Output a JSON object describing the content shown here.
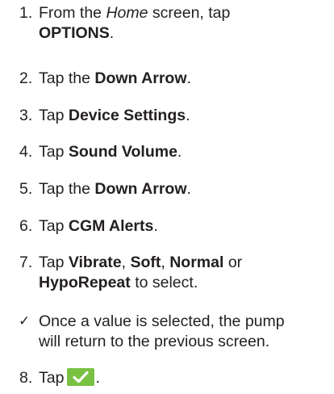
{
  "steps": [
    {
      "num": "1.",
      "parts": [
        {
          "t": "From the ",
          "s": "light"
        },
        {
          "t": "Home",
          "s": "ital"
        },
        {
          "t": " screen, tap",
          "s": "light"
        }
      ],
      "line2": [
        {
          "t": "OPTIONS",
          "s": "bold"
        },
        {
          "t": ".",
          "s": "light"
        }
      ]
    },
    {
      "num": "2.",
      "parts": [
        {
          "t": "Tap the ",
          "s": "light"
        },
        {
          "t": "Down Arrow",
          "s": "bold"
        },
        {
          "t": ".",
          "s": "light"
        }
      ]
    },
    {
      "num": "3.",
      "parts": [
        {
          "t": "Tap ",
          "s": "light"
        },
        {
          "t": "Device Settings",
          "s": "bold"
        },
        {
          "t": ".",
          "s": "light"
        }
      ]
    },
    {
      "num": "4.",
      "parts": [
        {
          "t": "Tap ",
          "s": "light"
        },
        {
          "t": "Sound Volume",
          "s": "bold"
        },
        {
          "t": ".",
          "s": "light"
        }
      ]
    },
    {
      "num": "5.",
      "parts": [
        {
          "t": "Tap the ",
          "s": "light"
        },
        {
          "t": "Down Arrow",
          "s": "bold"
        },
        {
          "t": ".",
          "s": "light"
        }
      ]
    },
    {
      "num": "6.",
      "parts": [
        {
          "t": "Tap ",
          "s": "light"
        },
        {
          "t": "CGM Alerts",
          "s": "bold"
        },
        {
          "t": ".",
          "s": "light"
        }
      ]
    },
    {
      "num": "7.",
      "parts": [
        {
          "t": "Tap ",
          "s": "light"
        },
        {
          "t": "Vibrate",
          "s": "bold"
        },
        {
          "t": ", ",
          "s": "light"
        },
        {
          "t": "Soft",
          "s": "bold"
        },
        {
          "t": ", ",
          "s": "light"
        },
        {
          "t": "Normal",
          "s": "bold"
        },
        {
          "t": " or",
          "s": "light"
        }
      ],
      "line2": [
        {
          "t": "HypoRepeat",
          "s": "bold"
        },
        {
          "t": " to select.",
          "s": "light"
        }
      ]
    }
  ],
  "note": {
    "mark": "✓",
    "line1": "Once a value is selected, the pump",
    "line2": "will return to the previous screen."
  },
  "final_step": {
    "num": "8.",
    "text": "Tap",
    "button_icon": "checkmark-icon",
    "end": "."
  },
  "colors": {
    "text": "#231f20",
    "button": "#79c143"
  }
}
